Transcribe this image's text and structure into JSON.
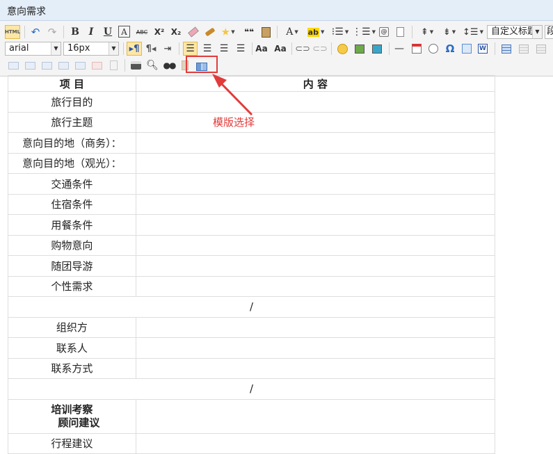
{
  "window": {
    "title": "意向需求"
  },
  "toolbar": {
    "source_label": "HTML",
    "heading_combo": "自定义标题",
    "paragraph_combo": "段",
    "font_family": "arial",
    "font_size": "16px",
    "row1_icons": [
      "html-source-icon",
      "undo-icon",
      "redo-icon",
      "bold-icon",
      "italic-icon",
      "underline-icon",
      "font-border-icon",
      "strikethrough-icon",
      "superscript-icon",
      "subscript-icon",
      "eraser-icon",
      "format-brush-icon",
      "auto-format-icon",
      "blockquote-icon",
      "paste-text-icon",
      "font-color-icon",
      "background-color-icon",
      "ordered-list-icon",
      "unordered-list-icon",
      "select-all-icon",
      "clear-doc-icon",
      "row-spacing-top-icon",
      "row-spacing-bottom-icon",
      "line-height-icon"
    ],
    "labels": {
      "bold": "B",
      "italic": "I",
      "underline": "U",
      "font_border": "A",
      "strike": "ABC",
      "sup": "X²",
      "sub": "X₂",
      "quote": "❝❝",
      "font_color": "A",
      "bg_color": "ab",
      "omega": "Ω",
      "dash": "—",
      "ltr": "¶",
      "rtl": "¶"
    }
  },
  "annotation": {
    "text": "模版选择",
    "color": "#e23b3b"
  },
  "table": {
    "header": {
      "left": "项 目",
      "right": "内 容"
    },
    "rows_a": [
      "旅行目的",
      "旅行主题",
      "意向目的地（商务）：",
      "意向目的地（观光）：",
      "交通条件",
      "住宿条件",
      "用餐条件",
      "购物意向",
      "随团导游",
      "个性需求"
    ],
    "divider": "/",
    "rows_b": [
      "组织方",
      "联系人",
      "联系方式"
    ],
    "bold_row": {
      "line1": "培训考察",
      "line2": "顾问建议"
    },
    "last_row": "行程建议"
  }
}
